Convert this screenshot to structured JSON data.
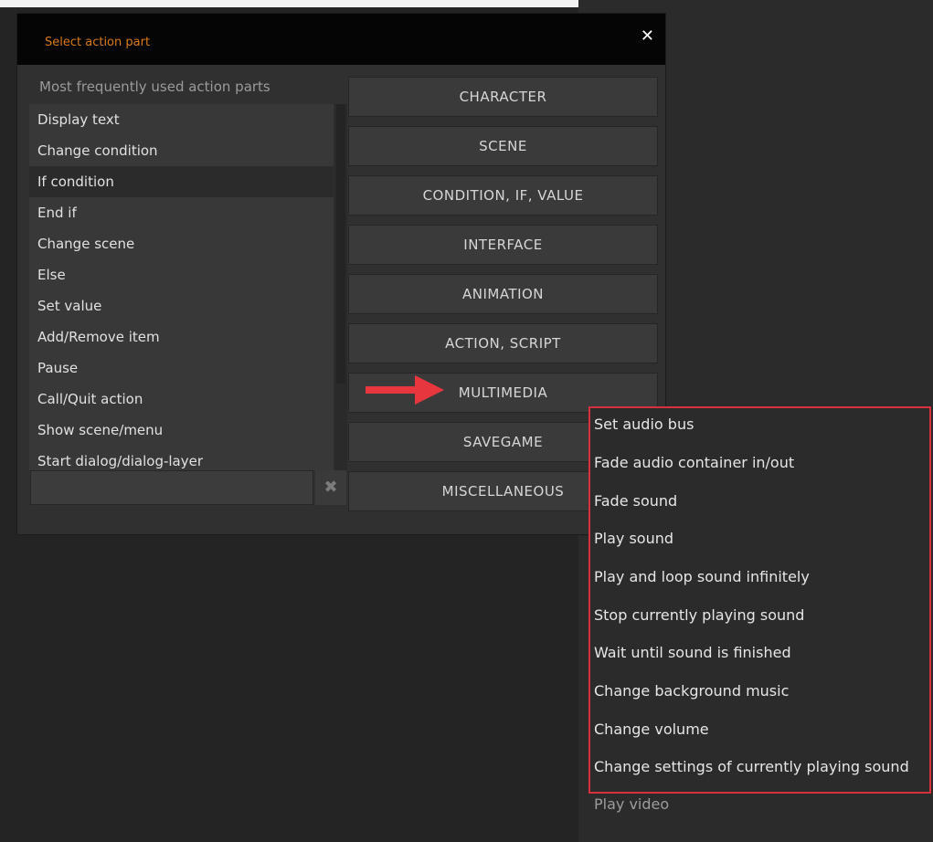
{
  "dialog": {
    "title": "Select action part",
    "close_label": "✕",
    "list_heading": "Most frequently used action parts",
    "list_items": [
      "Display text",
      "Change condition",
      "If condition",
      "End if",
      "Change scene",
      "Else",
      "Set value",
      "Add/Remove item",
      "Pause",
      "Call/Quit action",
      "Show scene/menu",
      "Start dialog/dialog-layer"
    ],
    "selected_item": "If condition",
    "search": {
      "value": "",
      "placeholder": ""
    },
    "clear_label": "✖",
    "categories": [
      "CHARACTER",
      "SCENE",
      "CONDITION, IF, VALUE",
      "INTERFACE",
      "ANIMATION",
      "ACTION, SCRIPT",
      "MULTIMEDIA",
      "SAVEGAME",
      "MISCELLANEOUS"
    ]
  },
  "submenu": {
    "items": [
      "Set audio bus",
      "Fade audio container in/out",
      "Fade sound",
      "Play sound",
      "Play and loop sound infinitely",
      "Stop currently playing sound",
      "Wait until sound is finished",
      "Change background music",
      "Change volume",
      "Change settings of currently playing sound"
    ],
    "extra_item": "Play video"
  },
  "colors": {
    "title_accent": "#d97a18",
    "highlight_border": "#d7303f",
    "arrow": "#e8363f"
  },
  "icons": {
    "close": "close-icon",
    "clear": "clear-icon",
    "pointer": "red-arrow-icon"
  }
}
